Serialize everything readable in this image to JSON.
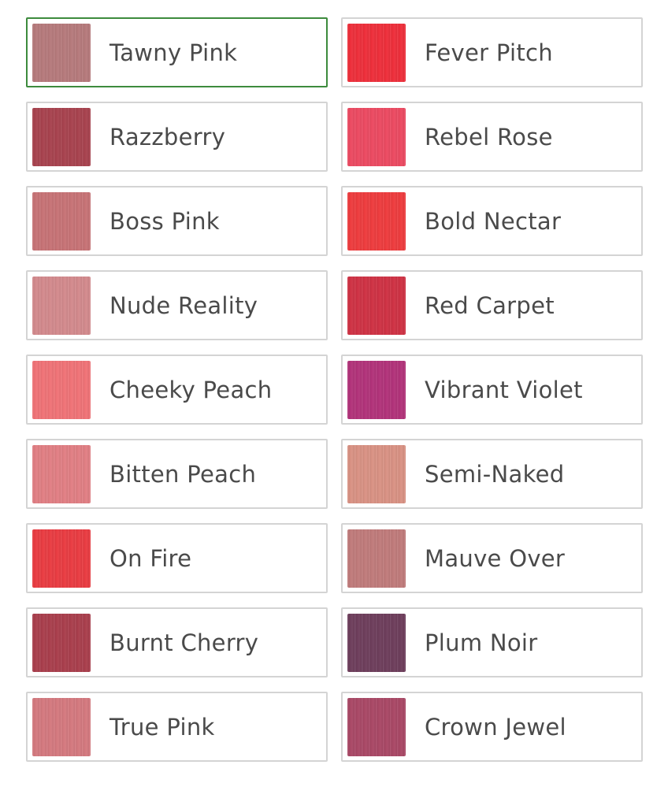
{
  "swatches": [
    {
      "label": "Tawny Pink",
      "color": "#b67a7c",
      "selected": true
    },
    {
      "label": "Fever Pitch",
      "color": "#ee2f3b",
      "selected": false
    },
    {
      "label": "Razzberry",
      "color": "#a8434f",
      "selected": false
    },
    {
      "label": "Rebel Rose",
      "color": "#ec4a62",
      "selected": false
    },
    {
      "label": "Boss Pink",
      "color": "#c77376",
      "selected": false
    },
    {
      "label": "Bold Nectar",
      "color": "#ee3c3e",
      "selected": false
    },
    {
      "label": "Nude Reality",
      "color": "#d38a8d",
      "selected": false
    },
    {
      "label": "Red Carpet",
      "color": "#cf3244",
      "selected": false
    },
    {
      "label": "Cheeky Peach",
      "color": "#f07377",
      "selected": false
    },
    {
      "label": "Vibrant Violet",
      "color": "#b2337a",
      "selected": false
    },
    {
      "label": "Bitten Peach",
      "color": "#e17f84",
      "selected": false
    },
    {
      "label": "Semi-Naked",
      "color": "#d99284",
      "selected": false
    },
    {
      "label": "On Fire",
      "color": "#e93c42",
      "selected": false
    },
    {
      "label": "Mauve Over",
      "color": "#c07b7b",
      "selected": false
    },
    {
      "label": "Burnt Cherry",
      "color": "#a93f4d",
      "selected": false
    },
    {
      "label": "Plum Noir",
      "color": "#6e3e5c",
      "selected": false
    },
    {
      "label": "True Pink",
      "color": "#d4797f",
      "selected": false
    },
    {
      "label": "Crown Jewel",
      "color": "#a94866",
      "selected": false
    }
  ]
}
